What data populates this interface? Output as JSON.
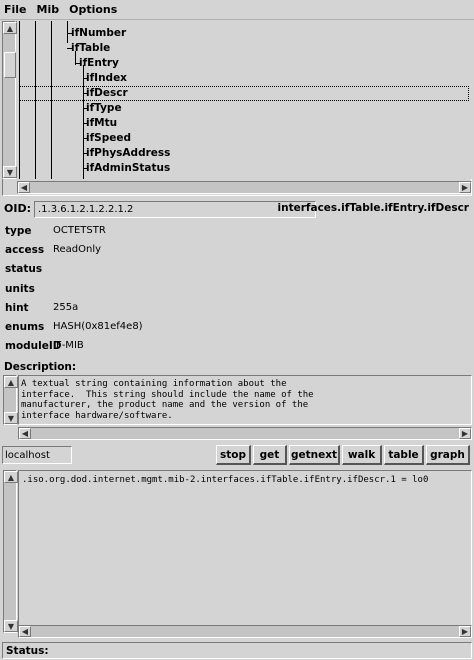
{
  "menu": [
    "File",
    "Mib",
    "Options"
  ],
  "tree": {
    "items": [
      {
        "label": "ifNumber"
      },
      {
        "label": "ifTable"
      },
      {
        "label": "ifEntry"
      },
      {
        "label": "ifIndex"
      },
      {
        "label": "ifDescr",
        "selected": true
      },
      {
        "label": "ifType"
      },
      {
        "label": "ifMtu"
      },
      {
        "label": "ifSpeed"
      },
      {
        "label": "ifPhysAddress"
      },
      {
        "label": "ifAdminStatus"
      }
    ]
  },
  "oid": {
    "label": "OID:",
    "value": ".1.3.6.1.2.1.2.2.1.2",
    "path": "interfaces.ifTable.ifEntry.ifDescr"
  },
  "attributes": [
    {
      "key": "type",
      "value": "OCTETSTR"
    },
    {
      "key": "access",
      "value": "ReadOnly"
    },
    {
      "key": "status",
      "value": ""
    },
    {
      "key": "units",
      "value": ""
    },
    {
      "key": "hint",
      "value": "255a"
    },
    {
      "key": "enums",
      "value": "HASH(0x81ef4e8)"
    },
    {
      "key": "moduleID",
      "value": "IF-MIB"
    }
  ],
  "description": {
    "label": "Description:",
    "text": "A textual string containing information about the\ninterface.  This string should include the name of the\nmanufacturer, the product name and the version of the\ninterface hardware/software."
  },
  "controls": {
    "host": "localhost",
    "buttons": [
      "stop",
      "get",
      "getnext",
      "walk",
      "table",
      "graph"
    ]
  },
  "output": ".iso.org.dod.internet.mgmt.mib-2.interfaces.ifTable.ifEntry.ifDescr.1 = lo0",
  "status": {
    "label": "Status:"
  }
}
